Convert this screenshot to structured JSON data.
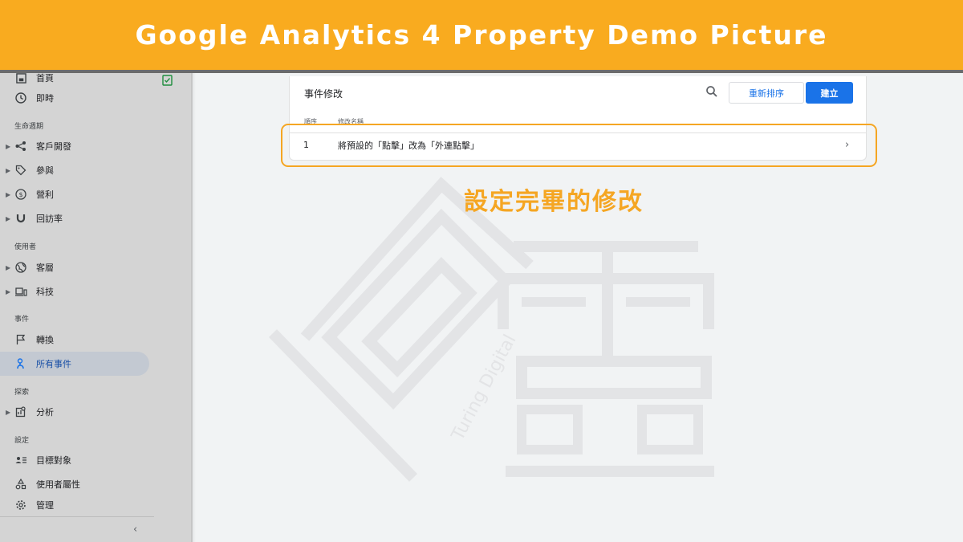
{
  "banner": {
    "title": "Google Analytics 4 Property Demo Picture"
  },
  "sidebar": {
    "items": [
      {
        "id": "home",
        "label": "首頁",
        "icon": "home-icon"
      },
      {
        "id": "realtime",
        "label": "即時",
        "icon": "clock-icon"
      },
      {
        "id": "acquisition",
        "label": "客戶開發",
        "icon": "acquisition-icon"
      },
      {
        "id": "engagement",
        "label": "參與",
        "icon": "tag-icon"
      },
      {
        "id": "monetization",
        "label": "營利",
        "icon": "dollar-icon"
      },
      {
        "id": "retention",
        "label": "回訪率",
        "icon": "magnet-icon"
      },
      {
        "id": "demographics",
        "label": "客層",
        "icon": "globe-icon"
      },
      {
        "id": "tech",
        "label": "科技",
        "icon": "devices-icon"
      },
      {
        "id": "conversions",
        "label": "轉換",
        "icon": "flag-icon"
      },
      {
        "id": "all-events",
        "label": "所有事件",
        "icon": "touch-icon"
      },
      {
        "id": "analysis",
        "label": "分析",
        "icon": "analysis-icon"
      },
      {
        "id": "audiences",
        "label": "目標對象",
        "icon": "audience-icon"
      },
      {
        "id": "user-properties",
        "label": "使用者屬性",
        "icon": "shapes-icon"
      },
      {
        "id": "admin",
        "label": "管理",
        "icon": "gear-icon"
      }
    ],
    "sections": {
      "lifecycle": "生命週期",
      "user": "使用者",
      "events": "事件",
      "explore": "探索",
      "configure": "設定"
    },
    "active": "all-events"
  },
  "card": {
    "title": "事件修改",
    "reorder_label": "重新排序",
    "create_label": "建立",
    "columns": {
      "order": "順序",
      "name": "修改名稱"
    },
    "rows": [
      {
        "order": "1",
        "name": "將預設的「點擊」改為「外連點擊」"
      }
    ]
  },
  "callout": {
    "text": "設定完畢的修改"
  },
  "watermark": {
    "text": "Turing Digital"
  },
  "colors": {
    "banner": "#f9ab1f",
    "accent": "#1a73e8",
    "highlight": "#f5a623"
  }
}
